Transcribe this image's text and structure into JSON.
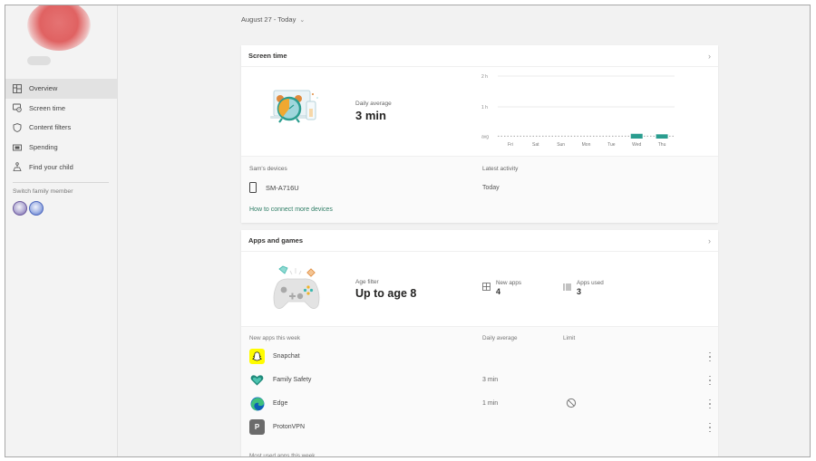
{
  "sidebar": {
    "items": [
      {
        "label": "Overview",
        "icon": "overview-icon",
        "active": true
      },
      {
        "label": "Screen time",
        "icon": "screen-time-icon",
        "active": false
      },
      {
        "label": "Content filters",
        "icon": "shield-icon",
        "active": false
      },
      {
        "label": "Spending",
        "icon": "wallet-icon",
        "active": false
      },
      {
        "label": "Find your child",
        "icon": "map-pin-person-icon",
        "active": false
      }
    ],
    "switch_label": "Switch family member"
  },
  "main": {
    "date_range": "August 27 - Today",
    "screen_time": {
      "title": "Screen time",
      "metric_label": "Daily average",
      "metric_value": "3 min",
      "devices_header": "Sam's devices",
      "activity_header": "Latest activity",
      "device_name": "SM-A716U",
      "device_activity": "Today",
      "connect_link": "How to connect more devices"
    },
    "apps": {
      "title": "Apps and games",
      "age_label": "Age filter",
      "age_value": "Up to age 8",
      "new_apps_label": "New apps",
      "new_apps_value": "4",
      "apps_used_label": "Apps used",
      "apps_used_value": "3",
      "col_new": "New apps this week",
      "col_avg": "Daily average",
      "col_limit": "Limit",
      "rows": [
        {
          "name": "Snapchat",
          "avg": "",
          "limit_blocked": false,
          "icon": "snapchat-icon"
        },
        {
          "name": "Family Safety",
          "avg": "3 min",
          "limit_blocked": false,
          "icon": "family-safety-icon"
        },
        {
          "name": "Edge",
          "avg": "1 min",
          "limit_blocked": true,
          "icon": "edge-icon"
        },
        {
          "name": "ProtonVPN",
          "avg": "",
          "limit_blocked": false,
          "icon": "protonvpn-icon"
        }
      ],
      "most_used": "Most used apps this week"
    }
  },
  "colors": {
    "accent": "#2a9d8f",
    "link": "#2e7d65",
    "snapchat": "#fffc00",
    "proton": "#6b6b6b"
  },
  "chart_data": {
    "type": "bar",
    "categories": [
      "Fri",
      "Sat",
      "Sun",
      "Mon",
      "Tue",
      "Wed",
      "Thu"
    ],
    "values": [
      0,
      0,
      0,
      0,
      0,
      4,
      3
    ],
    "unit": "min",
    "y_ticks": [
      "avg",
      "1 h",
      "2 h"
    ],
    "ylim": [
      0,
      120
    ],
    "avg_line": 3,
    "grid": true
  }
}
